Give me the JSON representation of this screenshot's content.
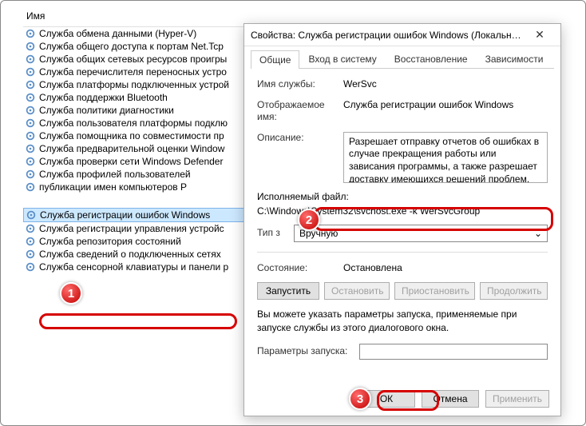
{
  "services_panel": {
    "column_header": "Имя",
    "items": [
      "Служба обмена данными (Hyper-V)",
      "Служба общего доступа к портам Net.Tcp",
      "Служба общих сетевых ресурсов проигры",
      "Служба перечислителя переносных устро",
      "Служба платформы подключенных устрой",
      "Служба поддержки Bluetooth",
      "Служба политики диагностики",
      "Служба пользователя платформы подклю",
      "Служба помощника по совместимости пр",
      "Служба предварительной оценки Window",
      "Служба проверки сети Windows Defender",
      "Служба профилей пользователей",
      "            публикации имен компьютеров P",
      "Служба регистрации ошибок Windows",
      "Служба регистрации управления устройс",
      "Служба репозитория состояний",
      "Служба сведений о подключенных сетях",
      "Служба сенсорной клавиатуры и панели р"
    ],
    "blank_between_12_13": "",
    "selected_index": 13
  },
  "dialog": {
    "title": "Свойства: Служба регистрации ошибок Windows (Локальный к...",
    "tabs": [
      "Общие",
      "Вход в систему",
      "Восстановление",
      "Зависимости"
    ],
    "active_tab": 0,
    "labels": {
      "service_name": "Имя службы:",
      "display_name": "Отображаемое имя:",
      "description": "Описание:",
      "exe": "Исполняемый файл:",
      "startup_type_truncated": "Тип з",
      "state": "Состояние:",
      "start_params": "Параметры запуска:"
    },
    "values": {
      "service_name": "WerSvc",
      "display_name": "Служба регистрации ошибок Windows",
      "description": "Разрешает отправку отчетов об ошибках в случае прекращения работы или зависания программы, а также разрешает доставку имеющихся решений проблем. Также",
      "exe_path": "C:\\Windows\\System32\\svchost.exe -k WerSvcGroup",
      "startup_type": "Вручную",
      "state": "Остановлена"
    },
    "buttons": {
      "start": "Запустить",
      "stop": "Остановить",
      "pause": "Приостановить",
      "resume": "Продолжить",
      "ok": "ОК",
      "cancel": "Отмена",
      "apply": "Применить"
    },
    "note": "Вы можете указать параметры запуска, применяемые при запуске службы из этого диалогового окна."
  },
  "callouts": {
    "b1": "1",
    "b2": "2",
    "b3": "3"
  }
}
